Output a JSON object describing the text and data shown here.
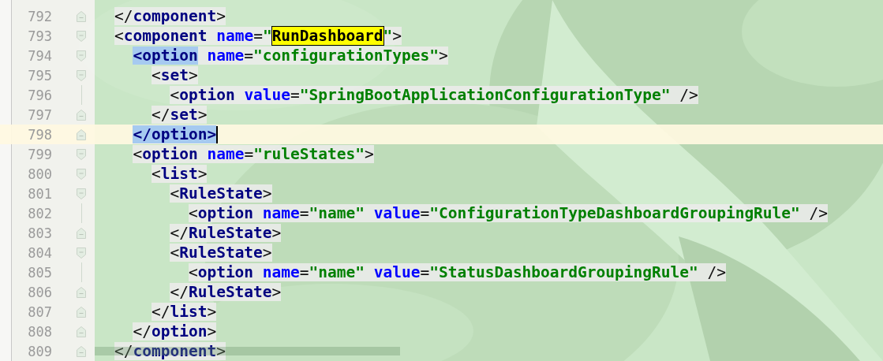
{
  "editor": {
    "lines": [
      {
        "number": "792",
        "current": false,
        "kind": "fold-end",
        "tokens": [
          {
            "kind": "punct",
            "text": "</"
          },
          {
            "kind": "tag",
            "text": "component"
          },
          {
            "kind": "punct",
            "text": ">"
          }
        ]
      },
      {
        "number": "793",
        "current": false,
        "kind": "fold-start",
        "tokens": [
          {
            "kind": "punct",
            "text": "<"
          },
          {
            "kind": "tag",
            "text": "component"
          },
          {
            "kind": "attr",
            "text": " name"
          },
          {
            "kind": "punct",
            "text": "="
          },
          {
            "kind": "value",
            "text": "\""
          },
          {
            "kind": "search",
            "text": "RunDashboard"
          },
          {
            "kind": "value",
            "text": "\""
          },
          {
            "kind": "punct",
            "text": ">"
          }
        ],
        "children": [
          {
            "number": "794",
            "current": false,
            "kind": "fold-start",
            "tokens": [
              {
                "kind": "matched",
                "text": "<option"
              },
              {
                "kind": "attr",
                "text": " name"
              },
              {
                "kind": "punct",
                "text": "="
              },
              {
                "kind": "value",
                "text": "\"configurationTypes\""
              },
              {
                "kind": "punct",
                "text": ">"
              }
            ],
            "children": [
              {
                "number": "795",
                "current": false,
                "kind": "fold-start",
                "tokens": [
                  {
                    "kind": "punct",
                    "text": "<"
                  },
                  {
                    "kind": "tag",
                    "text": "set"
                  },
                  {
                    "kind": "punct",
                    "text": ">"
                  }
                ],
                "children": [
                  {
                    "number": "796",
                    "current": false,
                    "kind": "plain",
                    "tokens": [
                      {
                        "kind": "punct",
                        "text": "<"
                      },
                      {
                        "kind": "tag",
                        "text": "option"
                      },
                      {
                        "kind": "attr",
                        "text": " value"
                      },
                      {
                        "kind": "punct",
                        "text": "="
                      },
                      {
                        "kind": "value",
                        "text": "\"SpringBootApplicationConfigurationType\""
                      },
                      {
                        "kind": "punct",
                        "text": " />"
                      }
                    ]
                  }
                ]
              },
              {
                "number": "797",
                "current": false,
                "kind": "fold-end",
                "tokens": [
                  {
                    "kind": "punct",
                    "text": "</"
                  },
                  {
                    "kind": "tag",
                    "text": "set"
                  },
                  {
                    "kind": "punct",
                    "text": ">"
                  }
                ]
              }
            ]
          },
          {
            "number": "798",
            "current": true,
            "kind": "fold-end",
            "caret": true,
            "tokens": [
              {
                "kind": "matched",
                "text": "</option>"
              }
            ]
          },
          {
            "number": "799",
            "current": false,
            "kind": "fold-start",
            "tokens": [
              {
                "kind": "punct",
                "text": "<"
              },
              {
                "kind": "tag",
                "text": "option"
              },
              {
                "kind": "attr",
                "text": " name"
              },
              {
                "kind": "punct",
                "text": "="
              },
              {
                "kind": "value",
                "text": "\"ruleStates\""
              },
              {
                "kind": "punct",
                "text": ">"
              }
            ],
            "children": [
              {
                "number": "800",
                "current": false,
                "kind": "fold-start",
                "tokens": [
                  {
                    "kind": "punct",
                    "text": "<"
                  },
                  {
                    "kind": "tag",
                    "text": "list"
                  },
                  {
                    "kind": "punct",
                    "text": ">"
                  }
                ],
                "children": [
                  {
                    "number": "801",
                    "current": false,
                    "kind": "fold-start",
                    "tokens": [
                      {
                        "kind": "punct",
                        "text": "<"
                      },
                      {
                        "kind": "tag",
                        "text": "RuleState"
                      },
                      {
                        "kind": "punct",
                        "text": ">"
                      }
                    ],
                    "children": [
                      {
                        "number": "802",
                        "current": false,
                        "kind": "plain",
                        "tokens": [
                          {
                            "kind": "punct",
                            "text": "<"
                          },
                          {
                            "kind": "tag",
                            "text": "option"
                          },
                          {
                            "kind": "attr",
                            "text": " name"
                          },
                          {
                            "kind": "punct",
                            "text": "="
                          },
                          {
                            "kind": "value",
                            "text": "\"name\""
                          },
                          {
                            "kind": "attr",
                            "text": " value"
                          },
                          {
                            "kind": "punct",
                            "text": "="
                          },
                          {
                            "kind": "value",
                            "text": "\"ConfigurationTypeDashboardGroupingRule\""
                          },
                          {
                            "kind": "punct",
                            "text": " />"
                          }
                        ]
                      }
                    ]
                  },
                  {
                    "number": "803",
                    "current": false,
                    "kind": "fold-end",
                    "tokens": [
                      {
                        "kind": "punct",
                        "text": "</"
                      },
                      {
                        "kind": "tag",
                        "text": "RuleState"
                      },
                      {
                        "kind": "punct",
                        "text": ">"
                      }
                    ]
                  },
                  {
                    "number": "804",
                    "current": false,
                    "kind": "fold-start",
                    "tokens": [
                      {
                        "kind": "punct",
                        "text": "<"
                      },
                      {
                        "kind": "tag",
                        "text": "RuleState"
                      },
                      {
                        "kind": "punct",
                        "text": ">"
                      }
                    ],
                    "children": [
                      {
                        "number": "805",
                        "current": false,
                        "kind": "plain",
                        "tokens": [
                          {
                            "kind": "punct",
                            "text": "<"
                          },
                          {
                            "kind": "tag",
                            "text": "option"
                          },
                          {
                            "kind": "attr",
                            "text": " name"
                          },
                          {
                            "kind": "punct",
                            "text": "="
                          },
                          {
                            "kind": "value",
                            "text": "\"name\""
                          },
                          {
                            "kind": "attr",
                            "text": " value"
                          },
                          {
                            "kind": "punct",
                            "text": "="
                          },
                          {
                            "kind": "value",
                            "text": "\"StatusDashboardGroupingRule\""
                          },
                          {
                            "kind": "punct",
                            "text": " />"
                          }
                        ]
                      }
                    ]
                  },
                  {
                    "number": "806",
                    "current": false,
                    "kind": "fold-end",
                    "tokens": [
                      {
                        "kind": "punct",
                        "text": "</"
                      },
                      {
                        "kind": "tag",
                        "text": "RuleState"
                      },
                      {
                        "kind": "punct",
                        "text": ">"
                      }
                    ]
                  }
                ]
              },
              {
                "number": "807",
                "current": false,
                "kind": "fold-end",
                "tokens": [
                  {
                    "kind": "punct",
                    "text": "</"
                  },
                  {
                    "kind": "tag",
                    "text": "list"
                  },
                  {
                    "kind": "punct",
                    "text": ">"
                  }
                ]
              }
            ]
          },
          {
            "number": "808",
            "current": false,
            "kind": "fold-end",
            "tokens": [
              {
                "kind": "punct",
                "text": "</"
              },
              {
                "kind": "tag",
                "text": "option"
              },
              {
                "kind": "punct",
                "text": ">"
              }
            ]
          }
        ]
      },
      {
        "number": "809",
        "current": false,
        "kind": "fold-end",
        "tokens": [
          {
            "kind": "punct",
            "text": "</"
          },
          {
            "kind": "tag",
            "text": "component"
          },
          {
            "kind": "punct",
            "text": ">"
          }
        ]
      }
    ]
  }
}
